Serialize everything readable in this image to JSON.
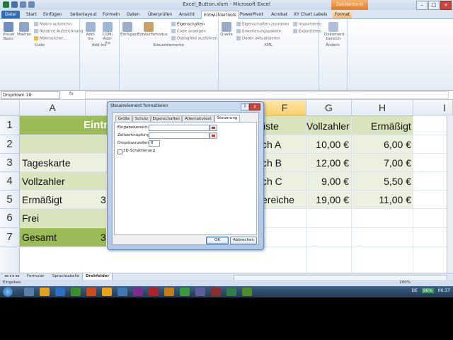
{
  "window": {
    "title": "Excel_Button.xlsm - Microsoft Excel",
    "context_tab_header": "Zeichentools"
  },
  "ribbon": {
    "tabs": [
      "Datei",
      "Start",
      "Einfügen",
      "Seitenlayout",
      "Formeln",
      "Daten",
      "Überprüfen",
      "Ansicht",
      "Entwicklertools",
      "PowerPivot",
      "Acrobat",
      "XY Chart Labels",
      "Format"
    ],
    "active_tab": "Entwicklertools",
    "groups": {
      "code": {
        "label": "Code",
        "visual_basic": "Visual Basic",
        "makros": "Makros",
        "makro_aufzeichnen": "Makro aufzeichn.",
        "relative_aufzeichnung": "Relative Aufzeichnung",
        "makrosicherheit": "Makrosicher..."
      },
      "addins": {
        "label": "Add-Ins",
        "addins": "Add-Ins",
        "com_addins": "COM-Add-Ins"
      },
      "steuerelemente": {
        "label": "Steuerelemente",
        "einfuegen": "Einfügen",
        "entwurfsmodus": "Entwurfsmodus",
        "eigenschaften": "Eigenschaften",
        "code_anzeigen": "Code anzeigen",
        "dialogfeld": "Dialogfeld ausführen"
      },
      "xml": {
        "label": "XML",
        "quelle": "Quelle",
        "eigenschaften_zuordnen": "Eigenschaften zuordnen",
        "erweiterungspakete": "Erweiterungspakete",
        "daten_aktualisieren": "Daten aktualisieren",
        "importieren": "Importieren",
        "exportieren": "Exportieren"
      },
      "aendern": {
        "label": "Ändern",
        "dokumentbereich": "Dokument-bereich"
      }
    }
  },
  "formula_bar": {
    "name_box": "Dropdown 18",
    "fx": "fx",
    "value": ""
  },
  "grid": {
    "columns": [
      "A",
      "F",
      "G",
      "H",
      "I"
    ],
    "rows": [
      "1",
      "2",
      "3",
      "4",
      "5",
      "6",
      "7"
    ],
    "cells": {
      "A1_partial": "Eintr",
      "F1": "iste",
      "G1": "Vollzahler",
      "H1": "Ermäßigt",
      "A3": "Tageskarte",
      "A4": "Vollzahler",
      "A5": "Ermäßigt",
      "A6": "Frei",
      "A7": "Gesamt",
      "A4_partial_b": "",
      "A5_partial_b": "3",
      "A7_partial_b": "3",
      "F2": "ch A",
      "F3": "ch B",
      "F4": "ch C",
      "F5": "ereiche",
      "G2": "10,00 €",
      "G3": "12,00 €",
      "G4": "9,00 €",
      "G5": "19,00 €",
      "H2": "6,00 €",
      "H3": "7,00 €",
      "H4": "5,50 €",
      "H5": "11,00 €"
    },
    "colors": {
      "header_green": "#9bbb59",
      "light_green": "#d8e4bc",
      "lighter_green": "#ebf1de",
      "selected_col": "#f8cf6b"
    }
  },
  "sheets": {
    "tabs": [
      "Formular",
      "Sprachtabelle",
      "Drehfelder"
    ],
    "active": "Drehfelder"
  },
  "status": {
    "mode": "Eingeben",
    "zoom": "200%"
  },
  "taskbar": {
    "lang": "DE",
    "battery": "96%",
    "time": "00:37"
  },
  "dialog": {
    "title": "Steuerelement formatieren",
    "help": "?",
    "close": "x",
    "tabs": [
      "Größe",
      "Schutz",
      "Eigenschaften",
      "Alternativtext",
      "Steuerung"
    ],
    "active_tab": "Steuerung",
    "fields": {
      "eingabebereich_label": "Eingabebereich:",
      "eingabebereich_value": "",
      "zellverknuepfung_label": "Zellverknüpfung:",
      "zellverknuepfung_value": "",
      "dropdownzeilen_label": "Dropdownzeilen:",
      "dropdownzeilen_value": "8",
      "schattierung_label": "3D-Schattierung",
      "schattierung_checked": false
    },
    "ok": "OK",
    "cancel": "Abbrechen"
  }
}
